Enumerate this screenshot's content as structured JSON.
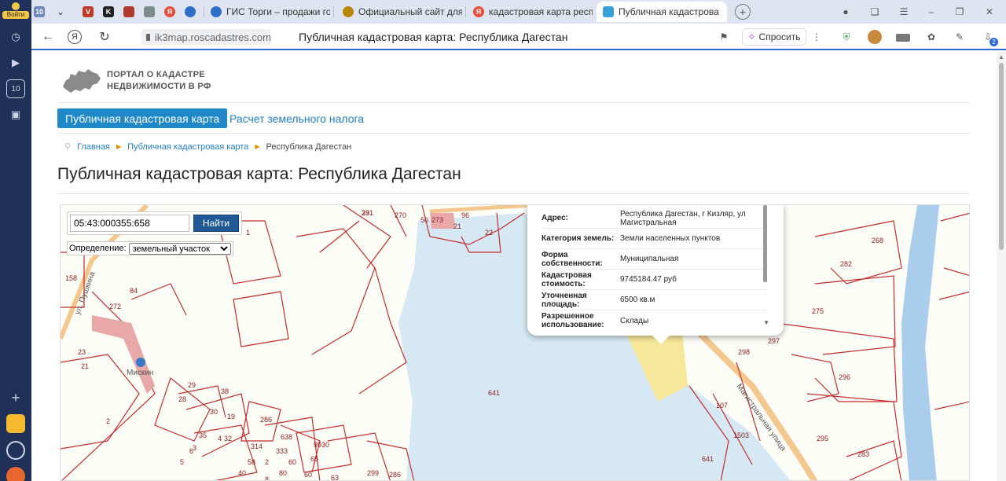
{
  "sidebar": {
    "login_label": "Войти",
    "items": [
      "clock",
      "play",
      "10",
      "media"
    ]
  },
  "tabs": [
    {
      "label": "",
      "icon": "10-icon"
    },
    {
      "label": "",
      "icon": "chevron-down-icon"
    },
    {
      "label": "",
      "icon": "v-icon"
    },
    {
      "label": "",
      "icon": "k-icon"
    },
    {
      "label": "",
      "icon": "crest-icon"
    },
    {
      "label": "",
      "icon": "doc-icon"
    },
    {
      "label": "",
      "icon": "yandex-icon"
    },
    {
      "label": "",
      "icon": "globe-icon"
    },
    {
      "label": "ГИС Торги – продажи гос"
    },
    {
      "label": "Официальный сайт для р"
    },
    {
      "label": "кадастровая карта респу"
    },
    {
      "label": "Публичная кадастрова",
      "active": true
    }
  ],
  "address_bar": {
    "url": "ik3map.roscadastres.com",
    "page_title": "Публичная кадастровая карта: Республика Дагестан",
    "ask_label": "Спросить",
    "download_badge": "2"
  },
  "site": {
    "logo_line1": "ПОРТАЛ О КАДАСТРЕ",
    "logo_line2": "НЕДВИЖИМОСТИ В РФ",
    "nav_map": "Публичная кадастровая карта",
    "nav_tax": "Расчет земельного налога",
    "breadcrumb": [
      "Главная",
      "Публичная кадастровая карта",
      "Республика Дагестан"
    ],
    "title": "Публичная кадастровая карта: Республика Дагестан"
  },
  "map": {
    "search_value": "05:43:000355:658",
    "search_button": "Найти",
    "definition_label": "Определение:",
    "definition_selected": "земельный участок",
    "street_labels": [
      "ул. Пушкина",
      "Магистральная улица"
    ],
    "poi_label": "Мискин",
    "parcel_numbers": [
      "291",
      "270",
      "50",
      "273",
      "96",
      "21",
      "22",
      "1",
      "158",
      "84",
      "272",
      "23",
      "21",
      "29",
      "28",
      "38",
      "30",
      "19",
      "2",
      "35",
      "32",
      "286",
      "638",
      "333",
      "314",
      "58",
      "9930",
      "60",
      "65",
      "299",
      "286",
      "641",
      "641",
      "268",
      "282",
      "275",
      "297",
      "298",
      "296",
      "107",
      "1503",
      "295",
      "283",
      "80",
      "63",
      "40",
      "60",
      "5",
      "6",
      "3",
      "4",
      "2",
      "8",
      "33"
    ]
  },
  "popup": {
    "rows": [
      {
        "key": "Адрес:",
        "value": "Республика Дагестан, г Кизляр, ул Магистральная"
      },
      {
        "key": "Категория земель:",
        "value": "Земли населенных пунктов"
      },
      {
        "key": "Форма собственности:",
        "value": "Муниципальная"
      },
      {
        "key": "Кадастровая стоимость:",
        "value": "9745184.47 руб"
      },
      {
        "key": "Уточненная площадь:",
        "value": "6500 кв.м"
      },
      {
        "key": "Разрешенное использование:",
        "value": "Склады"
      }
    ]
  },
  "colors": {
    "sidebar": "#1f3159",
    "accent": "#1e88c9",
    "parcel_line": "#c42b2b",
    "water": "#d6e8f3",
    "river": "#a9cdea",
    "selected_parcel": "#f7e79a"
  }
}
